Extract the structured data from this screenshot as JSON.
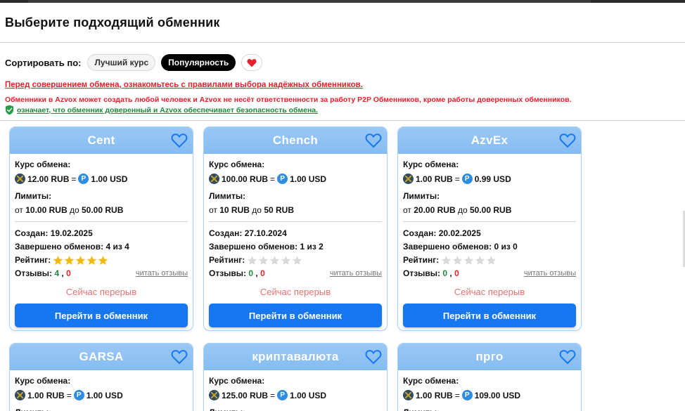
{
  "page": {
    "title": "Выберите подходящий обменник"
  },
  "sort": {
    "label": "Сортировать по:",
    "options": [
      "Лучший курс",
      "Популярность"
    ],
    "active": "Популярность",
    "favorites_icon": "heart-icon"
  },
  "notices": {
    "rules_link": "Перед совершением обмена, ознакомьтесь с правилами выбора надёжных обменников.",
    "warning": "Обменники в Azvox может создать любой человек и Azvox не несёт ответственности за работу P2P Обменников, кроме работы доверенных обменников.",
    "trusted_note": "означает, что обменник доверенный и Azvox обеспечивает безопасность обмена."
  },
  "labels": {
    "rate": "Курс обмена:",
    "limits": "Лимиты:",
    "limit_from": "от",
    "limit_to": "до",
    "created": "Создан:",
    "completed": "Завершено обменов:",
    "rating": "Рейтинг:",
    "reviews": "Отзывы:",
    "read_reviews": "читать отзывы",
    "break_status": "Сейчас перерыв",
    "go_button": "Перейти в обменник"
  },
  "exchangers": [
    {
      "name": "Cent",
      "rate_from": "12.00 RUB",
      "rate_to": "1.00 USD",
      "limit_min": "10.00 RUB",
      "limit_max": "50.00 RUB",
      "created": "19.02.2025",
      "completed": "4 из 4",
      "rating_stars": 5,
      "reviews_positive": "4",
      "reviews_negative": "0"
    },
    {
      "name": "Chench",
      "rate_from": "100.00 RUB",
      "rate_to": "1.00 USD",
      "limit_min": "10 RUB",
      "limit_max": "50 RUB",
      "created": "27.10.2024",
      "completed": "1 из 2",
      "rating_stars": 0,
      "reviews_positive": "0",
      "reviews_negative": "0"
    },
    {
      "name": "AzvEx",
      "rate_from": "1.00 RUB",
      "rate_to": "0.99 USD",
      "limit_min": "20.00 RUB",
      "limit_max": "50.00 RUB",
      "created": "20.02.2025",
      "completed": "0 из 0",
      "rating_stars": 0,
      "reviews_positive": "0",
      "reviews_negative": "0"
    },
    {
      "name": "GARSA",
      "rate_from": "1.00 RUB",
      "rate_to": "1.00 USD"
    },
    {
      "name": "криптавалюта",
      "rate_from": "125.00 RUB",
      "rate_to": "1.00 USD"
    },
    {
      "name": "прго",
      "rate_from": "1.00 RUB",
      "rate_to": "109.00 USD"
    }
  ],
  "colors": {
    "accent_blue": "#1677f0",
    "card_header": "#8fc2f3",
    "warning_red": "#e3222b",
    "trusted_green": "#1f8a3a",
    "star_gold": "#f5b80b",
    "star_empty": "#d9d9d9"
  }
}
